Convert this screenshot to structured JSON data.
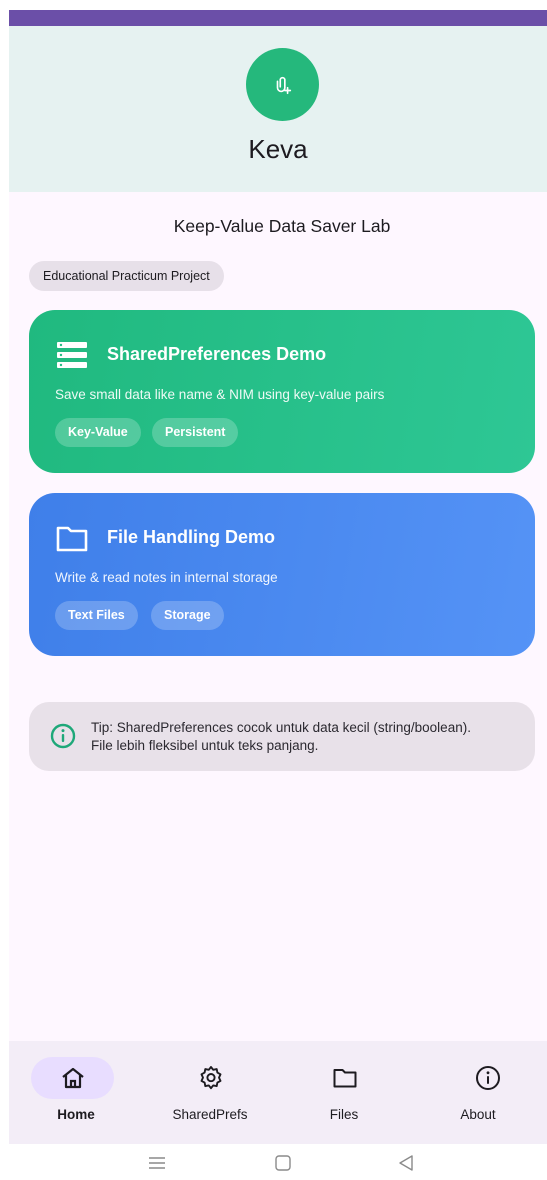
{
  "app": {
    "name": "Keva",
    "lab_title": "Keep-Value Data Saver Lab",
    "project_chip": "Educational Practicum Project"
  },
  "cards": [
    {
      "title": "SharedPreferences Demo",
      "description": "Save small data like name & NIM using key-value pairs",
      "tags": [
        "Key-Value",
        "Persistent"
      ],
      "icon": "list-icon",
      "color": "#25bd84"
    },
    {
      "title": "File Handling Demo",
      "description": "Write & read notes in internal storage",
      "tags": [
        "Text Files",
        "Storage"
      ],
      "icon": "folder-icon",
      "color": "#4a8af1"
    }
  ],
  "tip": {
    "line1": "Tip: SharedPreferences cocok untuk data kecil (string/boolean).",
    "line2": "File lebih fleksibel untuk teks panjang.",
    "icon": "info-icon"
  },
  "bottom_nav": [
    {
      "label": "Home",
      "icon": "home-icon",
      "active": true
    },
    {
      "label": "SharedPrefs",
      "icon": "settings-gear-icon",
      "active": false
    },
    {
      "label": "Files",
      "icon": "folder-icon",
      "active": false
    },
    {
      "label": "About",
      "icon": "info-icon",
      "active": false
    }
  ],
  "colors": {
    "primary_purple": "#6b4fa8",
    "accent_green": "#25b87c",
    "accent_blue": "#4a8af1",
    "background": "#fef7ff"
  }
}
